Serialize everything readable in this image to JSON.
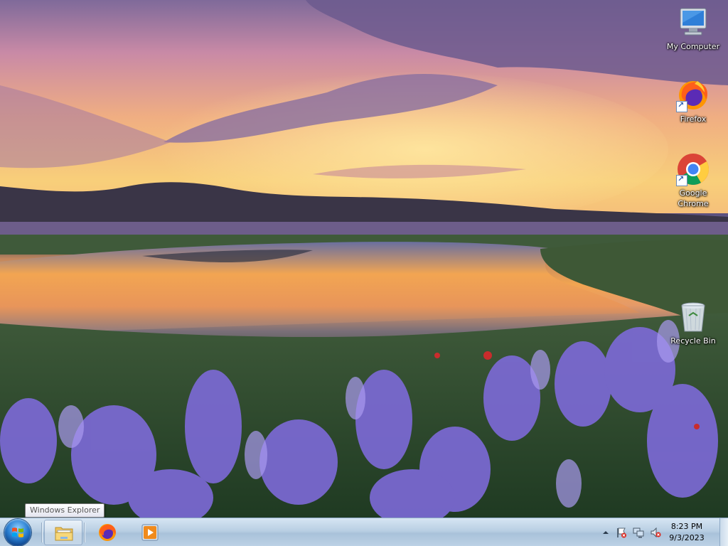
{
  "desktop": {
    "icons": [
      {
        "label": "My Computer",
        "icon": "computer-icon"
      },
      {
        "label": "Firefox",
        "icon": "firefox-icon"
      },
      {
        "label": "Google Chrome",
        "icon": "chrome-icon"
      },
      {
        "label": "Recycle Bin",
        "icon": "recycle-bin-icon"
      }
    ]
  },
  "tooltip": {
    "text": "Windows Explorer"
  },
  "taskbar": {
    "start": {
      "icon": "windows-start-icon"
    },
    "pinned": [
      {
        "name": "Windows Explorer",
        "icon": "folder-icon",
        "active": true
      },
      {
        "name": "Firefox",
        "icon": "firefox-icon",
        "active": false
      },
      {
        "name": "Media Player",
        "icon": "media-player-icon",
        "active": false
      }
    ],
    "tray": {
      "icons": [
        "show-hidden-icons-chevron",
        "action-center-flag-icon",
        "network-icon",
        "volume-muted-icon"
      ],
      "time": "8:23 PM",
      "date": "9/3/2023"
    }
  },
  "colors": {
    "taskbar": "#b9cfe3",
    "label_text": "#ffffff"
  }
}
